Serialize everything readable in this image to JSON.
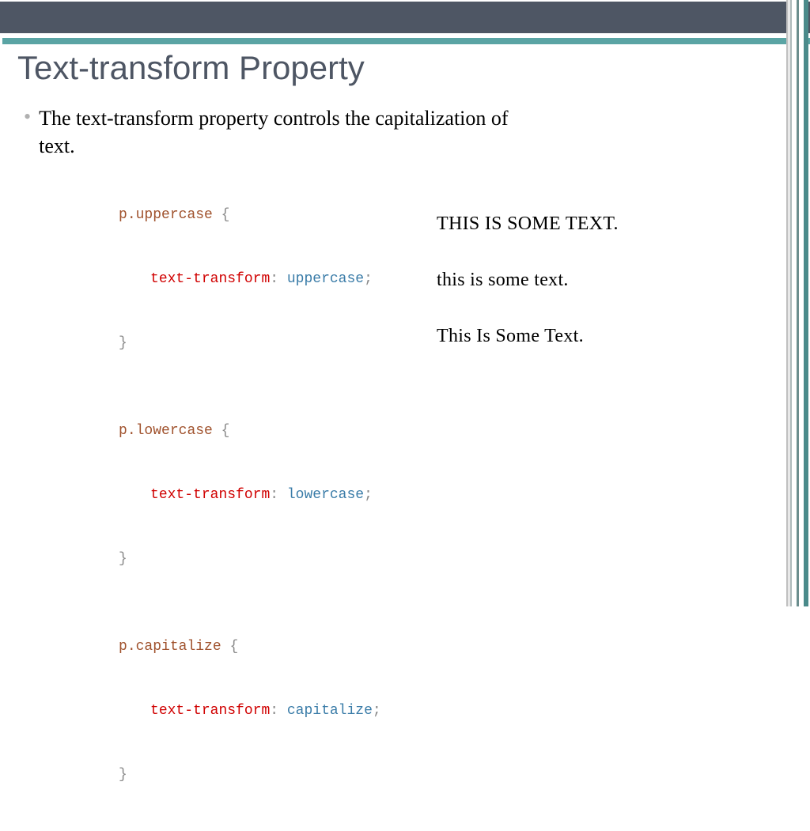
{
  "title": "Text-transform Property",
  "bullet_text": "The text-transform property controls the capitalization of text.",
  "code": {
    "block1": {
      "selector": "p.uppercase",
      "open": " {",
      "prop": "text-transform",
      "colon": ": ",
      "val": "uppercase",
      "semi": ";",
      "close": "}"
    },
    "block2": {
      "selector": "p.lowercase",
      "open": " {",
      "prop": "text-transform",
      "colon": ": ",
      "val": "lowercase",
      "semi": ";",
      "close": "}"
    },
    "block3": {
      "selector": "p.capitalize",
      "open": " {",
      "prop": "text-transform",
      "colon": ": ",
      "val": "capitalize",
      "semi": ";",
      "close": "}"
    }
  },
  "output": {
    "line1": "THIS IS SOME TEXT.",
    "line2": "this is some text.",
    "line3": "This Is Some Text."
  }
}
